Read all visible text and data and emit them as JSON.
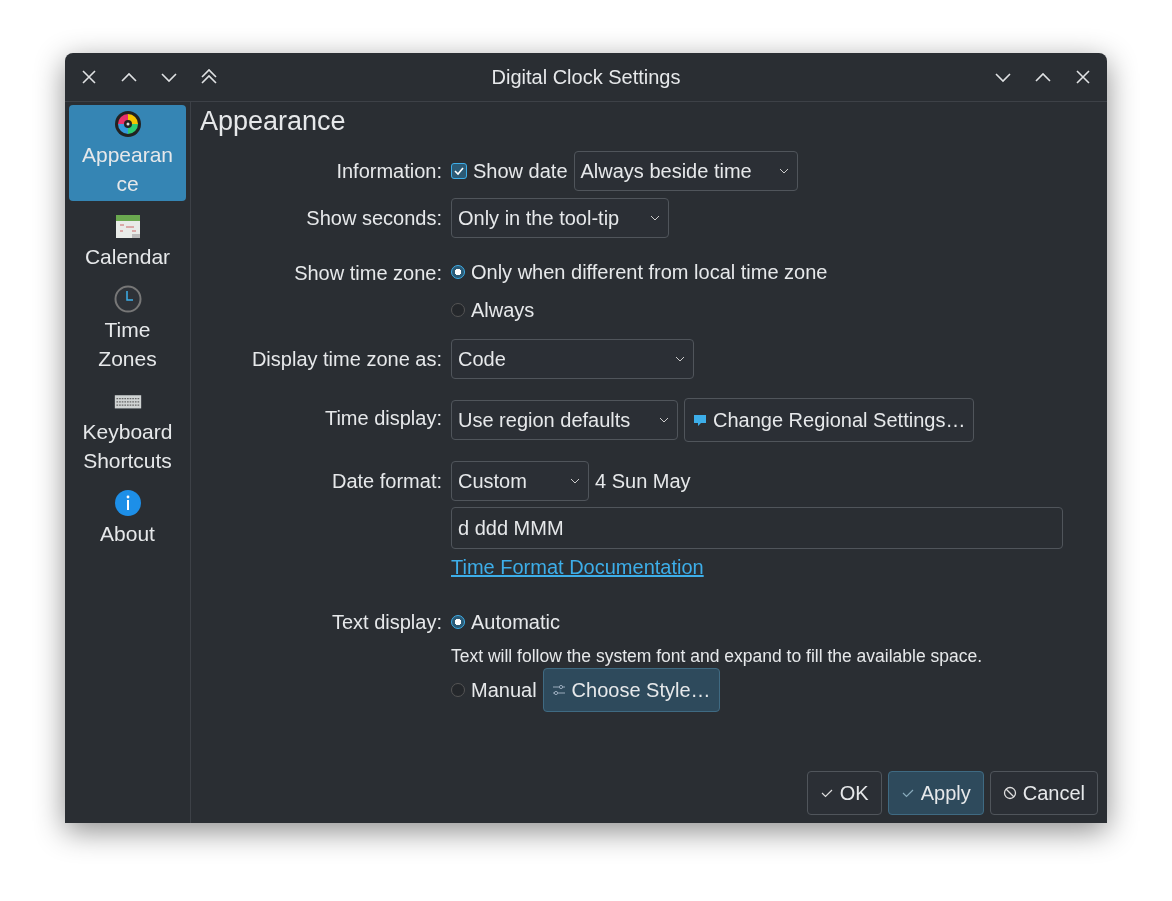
{
  "window": {
    "title": "Digital Clock Settings"
  },
  "sidebar": {
    "items": [
      {
        "label": "Appearance",
        "selected": true
      },
      {
        "label": "Calendar",
        "selected": false
      },
      {
        "label": "Time Zones",
        "selected": false
      },
      {
        "label": "Keyboard Shortcuts",
        "selected": false
      },
      {
        "label": "About",
        "selected": false
      }
    ]
  },
  "page": {
    "title": "Appearance"
  },
  "form": {
    "information": {
      "label": "Information:",
      "show_date": {
        "label": "Show date",
        "checked": true
      },
      "dropdown": {
        "value": "Always beside time"
      }
    },
    "show_seconds": {
      "label": "Show seconds:",
      "dropdown": {
        "value": "Only in the tool-tip"
      }
    },
    "show_time_zone": {
      "label": "Show time zone:",
      "options": [
        {
          "label": "Only when different from local time zone",
          "selected": true
        },
        {
          "label": "Always",
          "selected": false
        }
      ]
    },
    "display_time_zone_as": {
      "label": "Display time zone as:",
      "dropdown": {
        "value": "Code"
      }
    },
    "time_display": {
      "label": "Time display:",
      "dropdown": {
        "value": "Use region defaults"
      },
      "button": "Change Regional Settings…"
    },
    "date_format": {
      "label": "Date format:",
      "dropdown": {
        "value": "Custom"
      },
      "preview": "4 Sun May",
      "value": "d ddd MMM",
      "link": "Time Format Documentation"
    },
    "text_display": {
      "label": "Text display:",
      "automatic": {
        "label": "Automatic",
        "selected": true
      },
      "note": "Text will follow the system font and expand to fill the available space.",
      "manual": {
        "label": "Manual",
        "selected": false
      },
      "button": "Choose Style…"
    }
  },
  "buttons": [
    {
      "label": "OK",
      "default": false
    },
    {
      "label": "Apply",
      "default": true
    },
    {
      "label": "Cancel",
      "default": false
    }
  ]
}
